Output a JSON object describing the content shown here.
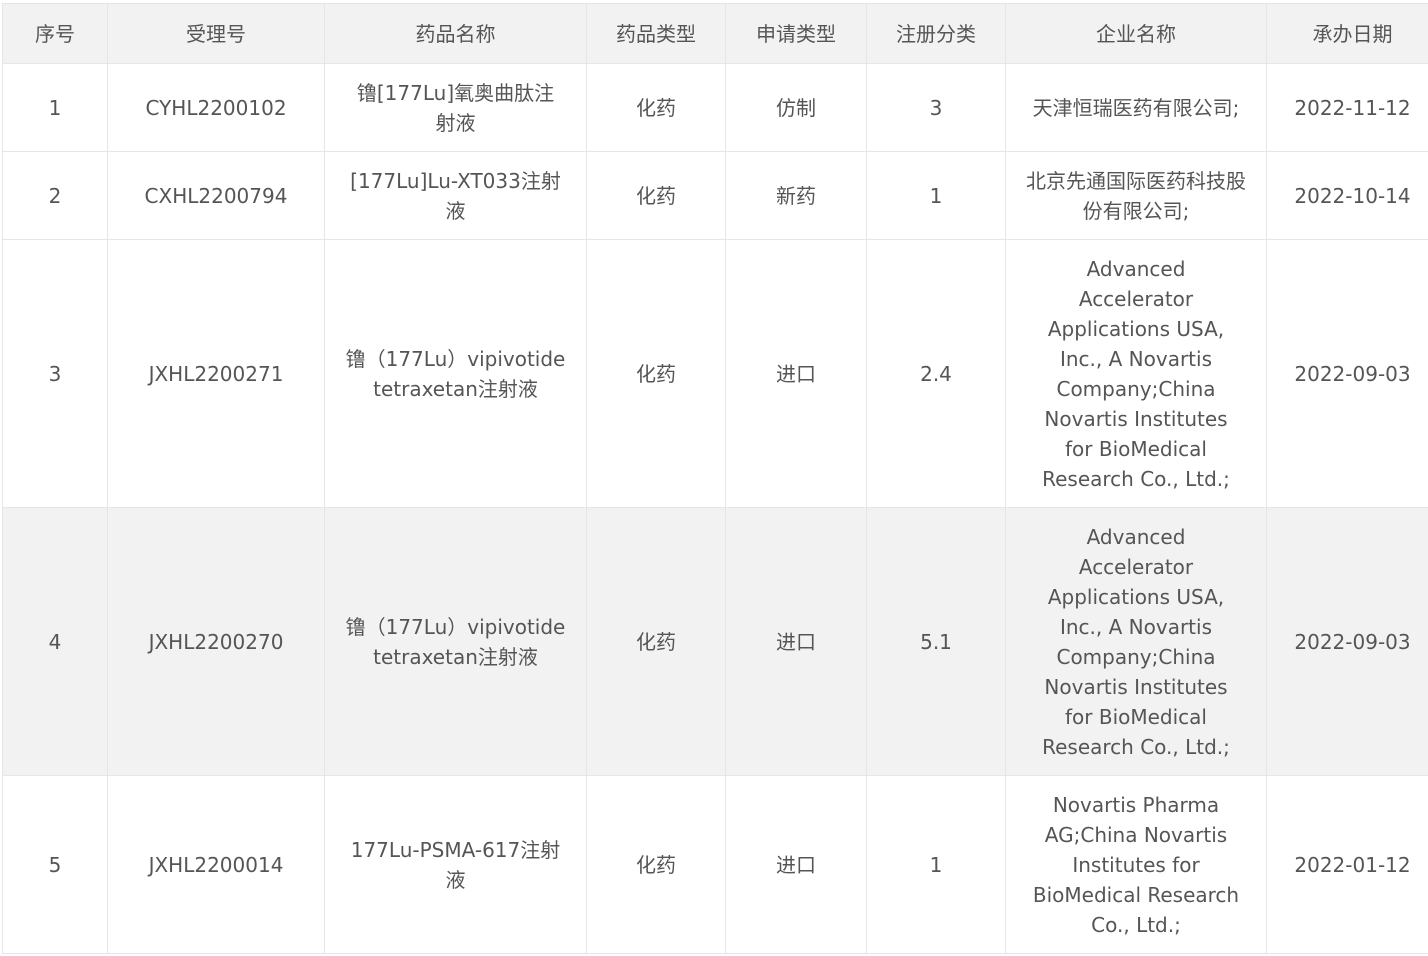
{
  "table": {
    "headers": [
      "序号",
      "受理号",
      "药品名称",
      "药品类型",
      "申请类型",
      "注册分类",
      "企业名称",
      "承办日期"
    ],
    "rows": [
      {
        "seq": "1",
        "acceptance_no": "CYHL2200102",
        "drug_name": "镥[177Lu]氧奥曲肽注射液",
        "drug_type": "化药",
        "application_type": "仿制",
        "registration_class": "3",
        "enterprise": "天津恒瑞医药有限公司;",
        "date": "2022-11-12"
      },
      {
        "seq": "2",
        "acceptance_no": "CXHL2200794",
        "drug_name": "[177Lu]Lu-XT033注射液",
        "drug_type": "化药",
        "application_type": "新药",
        "registration_class": "1",
        "enterprise": "北京先通国际医药科技股份有限公司;",
        "date": "2022-10-14"
      },
      {
        "seq": "3",
        "acceptance_no": "JXHL2200271",
        "drug_name": "镥（177Lu）vipivotide tetraxetan注射液",
        "drug_type": "化药",
        "application_type": "进口",
        "registration_class": "2.4",
        "enterprise": "Advanced Accelerator Applications USA, Inc., A Novartis Company;China Novartis Institutes for BioMedical Research Co., Ltd.;",
        "date": "2022-09-03"
      },
      {
        "seq": "4",
        "acceptance_no": "JXHL2200270",
        "drug_name": "镥（177Lu）vipivotide tetraxetan注射液",
        "drug_type": "化药",
        "application_type": "进口",
        "registration_class": "5.1",
        "enterprise": "Advanced Accelerator Applications USA, Inc., A Novartis Company;China Novartis Institutes for BioMedical Research Co., Ltd.;",
        "date": "2022-09-03"
      },
      {
        "seq": "5",
        "acceptance_no": "JXHL2200014",
        "drug_name": "177Lu-PSMA-617注射液",
        "drug_type": "化药",
        "application_type": "进口",
        "registration_class": "1",
        "enterprise": "Novartis Pharma AG;China Novartis Institutes for BioMedical Research Co., Ltd.;",
        "date": "2022-01-12"
      }
    ]
  }
}
